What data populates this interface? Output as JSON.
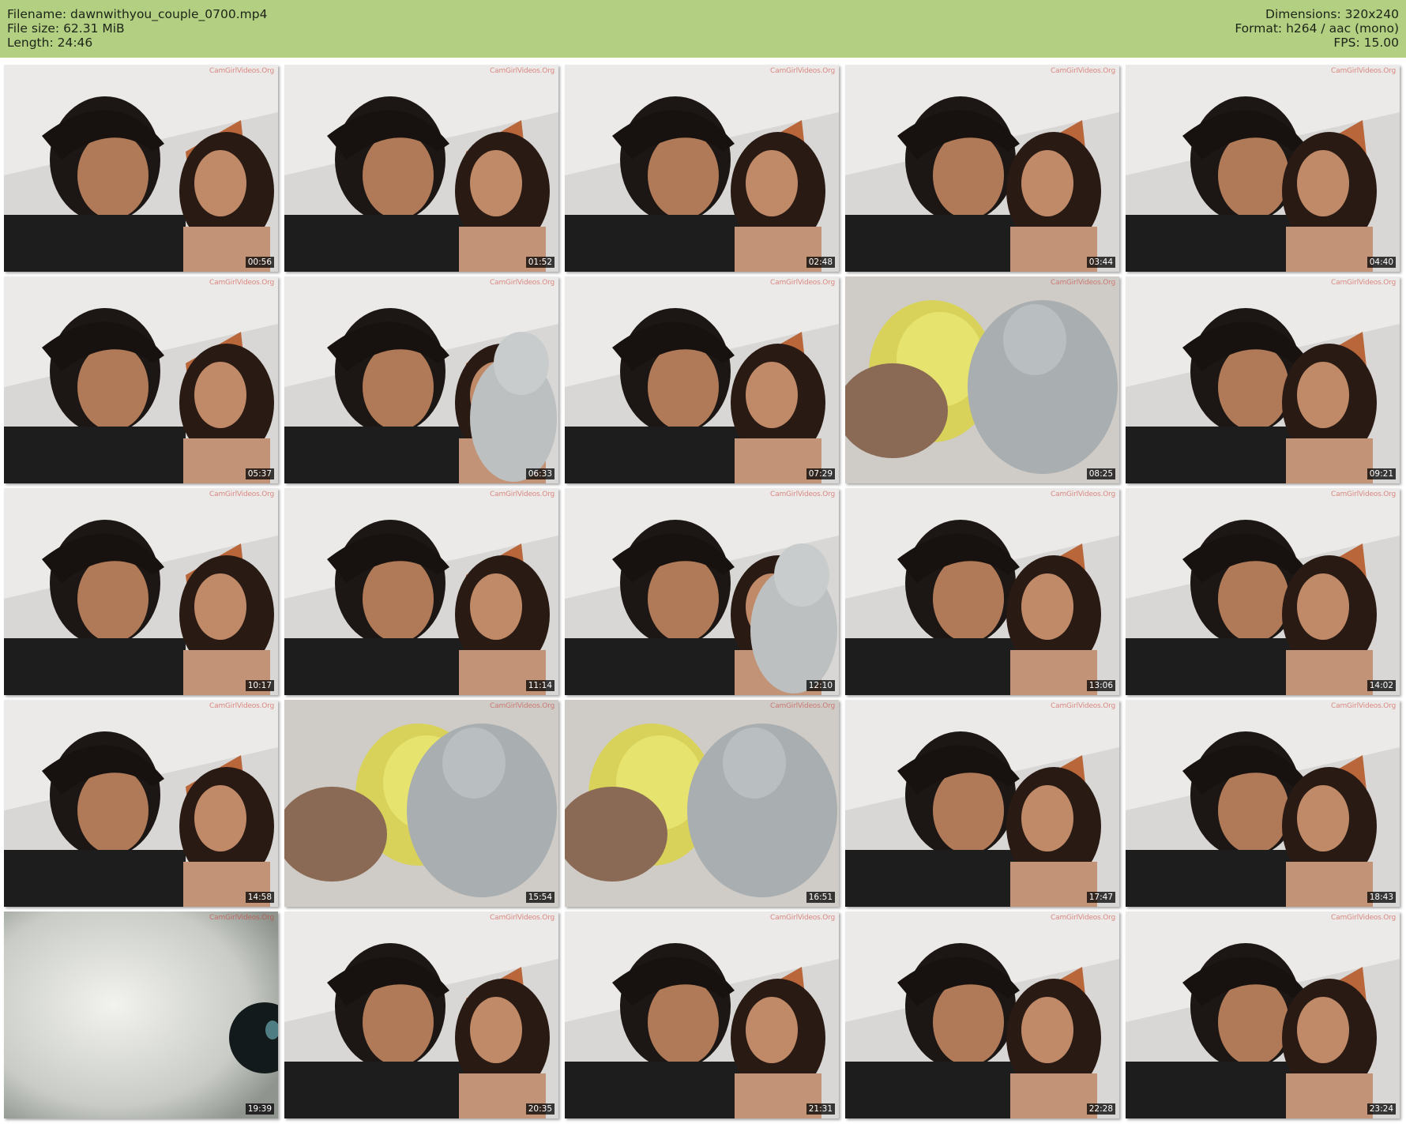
{
  "header": {
    "filename_label": "Filename: dawnwithyou_couple_0700.mp4",
    "filesize_label": "File size: 62.31 MiB",
    "length_label": "Length: 24:46",
    "dimensions_label": "Dimensions: 320x240",
    "format_label": "Format: h264 / aac (mono)",
    "fps_label": "FPS: 15.00"
  },
  "watermark": "CamGirlVideos.Org",
  "thumbnails": [
    {
      "timestamp": "00:56",
      "scene": "couple"
    },
    {
      "timestamp": "01:52",
      "scene": "couple"
    },
    {
      "timestamp": "02:48",
      "scene": "couple"
    },
    {
      "timestamp": "03:44",
      "scene": "couple"
    },
    {
      "timestamp": "04:40",
      "scene": "couple"
    },
    {
      "timestamp": "05:37",
      "scene": "couple"
    },
    {
      "timestamp": "06:33",
      "scene": "couple-plush"
    },
    {
      "timestamp": "07:29",
      "scene": "couple"
    },
    {
      "timestamp": "08:25",
      "scene": "plush-closeup"
    },
    {
      "timestamp": "09:21",
      "scene": "couple"
    },
    {
      "timestamp": "10:17",
      "scene": "couple"
    },
    {
      "timestamp": "11:14",
      "scene": "couple"
    },
    {
      "timestamp": "12:10",
      "scene": "couple-plush"
    },
    {
      "timestamp": "13:06",
      "scene": "couple"
    },
    {
      "timestamp": "14:02",
      "scene": "couple"
    },
    {
      "timestamp": "14:58",
      "scene": "couple"
    },
    {
      "timestamp": "15:54",
      "scene": "plush-closeup"
    },
    {
      "timestamp": "16:51",
      "scene": "plush-closeup"
    },
    {
      "timestamp": "17:47",
      "scene": "couple"
    },
    {
      "timestamp": "18:43",
      "scene": "couple"
    },
    {
      "timestamp": "19:39",
      "scene": "blur-closeup"
    },
    {
      "timestamp": "20:35",
      "scene": "couple"
    },
    {
      "timestamp": "21:31",
      "scene": "couple"
    },
    {
      "timestamp": "22:28",
      "scene": "couple"
    },
    {
      "timestamp": "23:24",
      "scene": "couple"
    }
  ]
}
